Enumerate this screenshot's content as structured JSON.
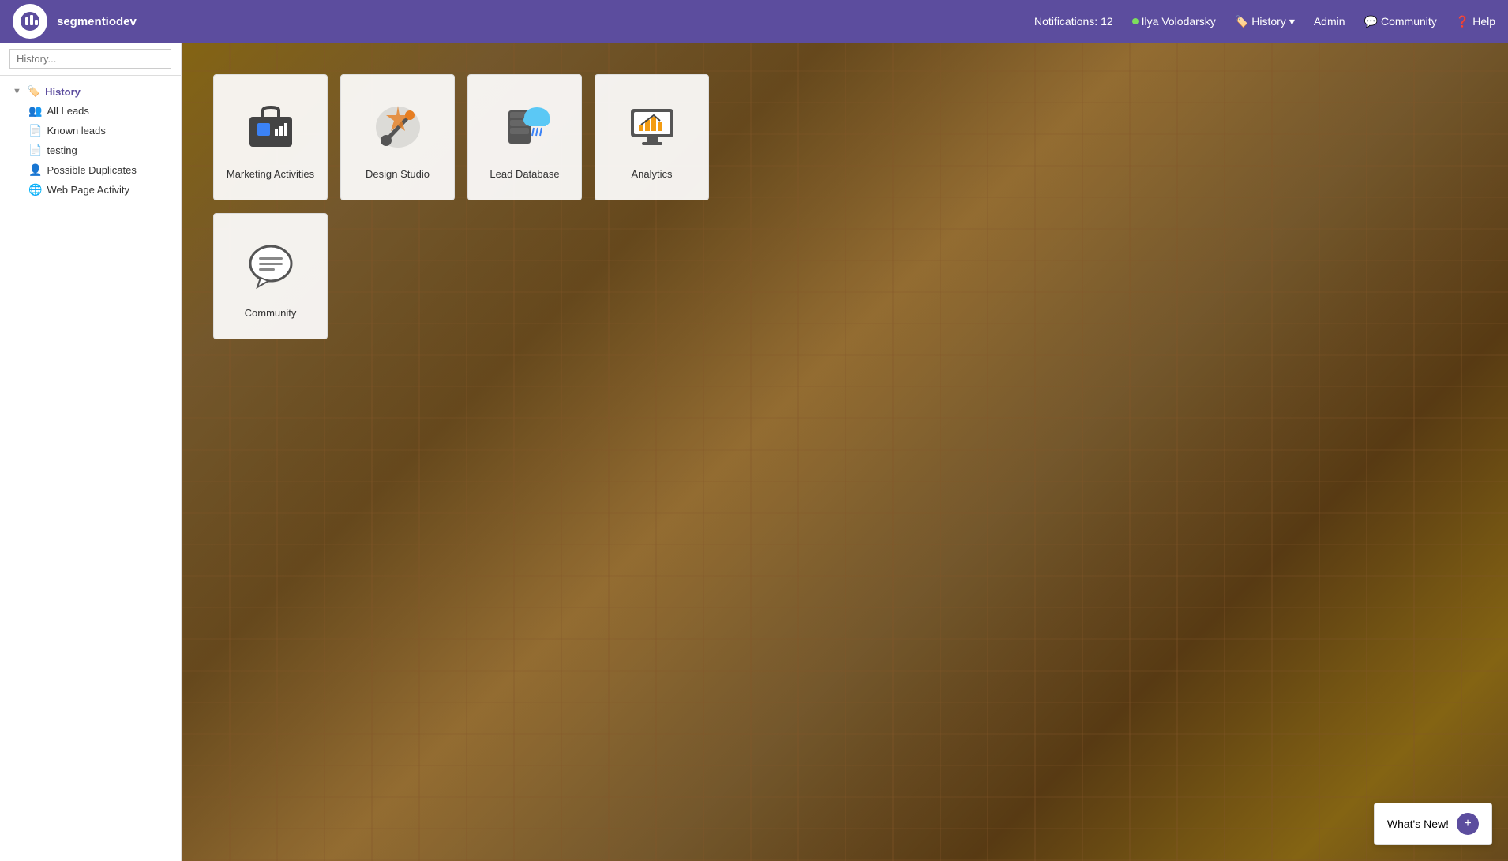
{
  "topnav": {
    "app_name": "segmentiodev",
    "notifications_label": "Notifications: 12",
    "user_name": "Ilya Volodarsky",
    "history_label": "History",
    "admin_label": "Admin",
    "community_label": "Community",
    "help_label": "Help"
  },
  "sidebar": {
    "search_placeholder": "History...",
    "tree": {
      "history_label": "History",
      "all_leads_label": "All Leads",
      "known_leads_label": "Known leads",
      "testing_label": "testing",
      "possible_duplicates_label": "Possible Duplicates",
      "web_page_activity_label": "Web Page Activity"
    }
  },
  "tiles": [
    {
      "id": "marketing-activities",
      "label": "Marketing Activities"
    },
    {
      "id": "design-studio",
      "label": "Design Studio"
    },
    {
      "id": "lead-database",
      "label": "Lead Database"
    },
    {
      "id": "analytics",
      "label": "Analytics"
    },
    {
      "id": "community",
      "label": "Community"
    }
  ],
  "whats_new": {
    "label": "What's New!"
  }
}
